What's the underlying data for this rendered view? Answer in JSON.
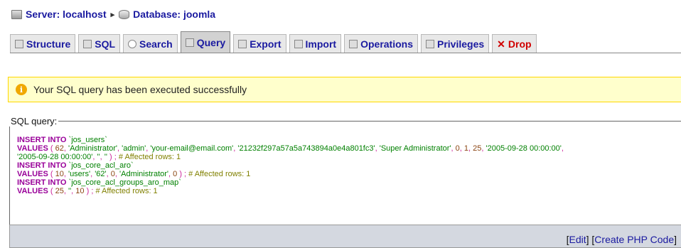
{
  "breadcrumb": {
    "server": "Server: localhost",
    "database": "Database: joomla"
  },
  "tabs": [
    {
      "label": "Structure",
      "icon": "structure-icon"
    },
    {
      "label": "SQL",
      "icon": "sql-icon"
    },
    {
      "label": "Search",
      "icon": "search-icon"
    },
    {
      "label": "Query",
      "icon": "query-icon",
      "active": true
    },
    {
      "label": "Export",
      "icon": "export-icon"
    },
    {
      "label": "Import",
      "icon": "import-icon"
    },
    {
      "label": "Operations",
      "icon": "operations-icon"
    },
    {
      "label": "Privileges",
      "icon": "privileges-icon"
    },
    {
      "label": "Drop",
      "icon": "drop-icon"
    }
  ],
  "message": {
    "text": "Your SQL query has been executed successfully"
  },
  "sql": {
    "legend": "SQL query:",
    "lines": [
      {
        "parts": [
          {
            "t": "kw",
            "v": "INSERT INTO"
          },
          {
            "t": "str",
            "v": " `jos_users`"
          }
        ]
      },
      {
        "parts": [
          {
            "t": "kw",
            "v": "VALUES"
          },
          {
            "t": "punc",
            "v": " ( "
          },
          {
            "t": "num",
            "v": "62"
          },
          {
            "t": "punc",
            "v": ", "
          },
          {
            "t": "str",
            "v": "'Administrator'"
          },
          {
            "t": "punc",
            "v": ", "
          },
          {
            "t": "str",
            "v": "'admin'"
          },
          {
            "t": "punc",
            "v": ", "
          },
          {
            "t": "str",
            "v": "'your-email@email.com'"
          },
          {
            "t": "punc",
            "v": ", "
          },
          {
            "t": "str",
            "v": "'21232f297a57a5a743894a0e4a801fc3'"
          },
          {
            "t": "punc",
            "v": ", "
          },
          {
            "t": "str",
            "v": "'Super Administrator'"
          },
          {
            "t": "punc",
            "v": ", "
          },
          {
            "t": "num",
            "v": "0"
          },
          {
            "t": "punc",
            "v": ", "
          },
          {
            "t": "num",
            "v": "1"
          },
          {
            "t": "punc",
            "v": ", "
          },
          {
            "t": "num",
            "v": "25"
          },
          {
            "t": "punc",
            "v": ", "
          },
          {
            "t": "str",
            "v": "'2005-09-28 00:00:00'"
          },
          {
            "t": "punc",
            "v": ","
          }
        ]
      },
      {
        "parts": [
          {
            "t": "str",
            "v": "'2005-09-28 00:00:00'"
          },
          {
            "t": "punc",
            "v": ", "
          },
          {
            "t": "str",
            "v": "''"
          },
          {
            "t": "punc",
            "v": ", "
          },
          {
            "t": "str",
            "v": "''"
          },
          {
            "t": "punc",
            "v": " ) ;  "
          },
          {
            "t": "cmt",
            "v": "# Affected rows: 1"
          }
        ]
      },
      {
        "parts": [
          {
            "t": "kw",
            "v": "INSERT INTO"
          },
          {
            "t": "str",
            "v": " `jos_core_acl_aro`"
          }
        ]
      },
      {
        "parts": [
          {
            "t": "kw",
            "v": "VALUES"
          },
          {
            "t": "punc",
            "v": " ( "
          },
          {
            "t": "num",
            "v": "10"
          },
          {
            "t": "punc",
            "v": ", "
          },
          {
            "t": "str",
            "v": "'users'"
          },
          {
            "t": "punc",
            "v": ", "
          },
          {
            "t": "str",
            "v": "'62'"
          },
          {
            "t": "punc",
            "v": ", "
          },
          {
            "t": "num",
            "v": "0"
          },
          {
            "t": "punc",
            "v": ", "
          },
          {
            "t": "str",
            "v": "'Administrator'"
          },
          {
            "t": "punc",
            "v": ", "
          },
          {
            "t": "num",
            "v": "0"
          },
          {
            "t": "punc",
            "v": " ) ;  "
          },
          {
            "t": "cmt",
            "v": "# Affected rows: 1"
          }
        ]
      },
      {
        "parts": [
          {
            "t": "kw",
            "v": "INSERT INTO"
          },
          {
            "t": "str",
            "v": " `jos_core_acl_groups_aro_map`"
          }
        ]
      },
      {
        "parts": [
          {
            "t": "kw",
            "v": "VALUES"
          },
          {
            "t": "punc",
            "v": " ( "
          },
          {
            "t": "num",
            "v": "25"
          },
          {
            "t": "punc",
            "v": ", "
          },
          {
            "t": "str",
            "v": "''"
          },
          {
            "t": "punc",
            "v": ", "
          },
          {
            "t": "num",
            "v": "10"
          },
          {
            "t": "punc",
            "v": " ) ;  "
          },
          {
            "t": "cmt",
            "v": "# Affected rows: 1"
          }
        ]
      }
    ]
  },
  "links": {
    "open1": "[",
    "edit": "Edit",
    "close1": "] [",
    "create_php": "Create PHP Code",
    "close2": "]"
  }
}
